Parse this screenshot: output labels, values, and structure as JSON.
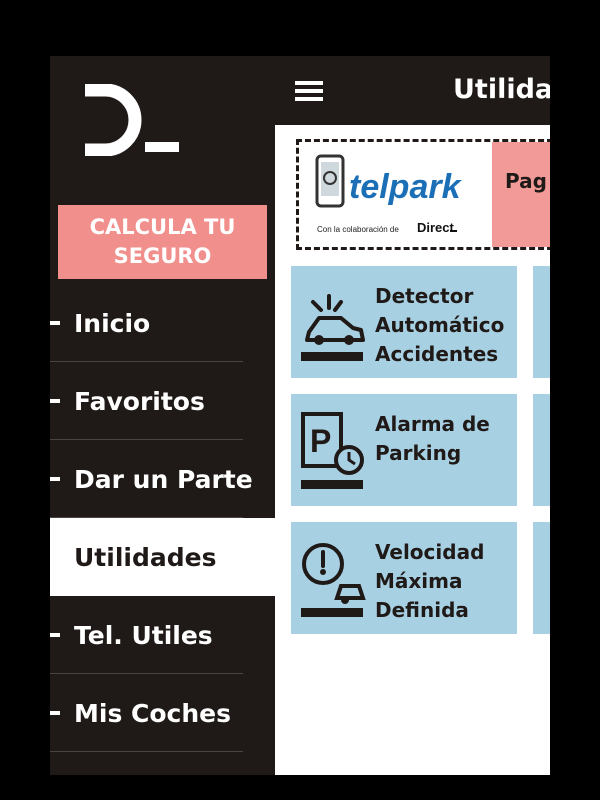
{
  "sidebar": {
    "cta_line1": "CALCULA TU",
    "cta_line2": "SEGURO",
    "items": [
      {
        "label": "Inicio"
      },
      {
        "label": "Favoritos"
      },
      {
        "label": "Dar un Parte"
      },
      {
        "label": "Utilidades",
        "active": true
      },
      {
        "label": "Tel. Utiles"
      },
      {
        "label": "Mis Coches"
      }
    ]
  },
  "header": {
    "title": "Utilidad"
  },
  "banner": {
    "brand": "telpark",
    "collab_text": "Con la colaboración de",
    "partner": "Direct",
    "pay_label": "Pag"
  },
  "tiles": [
    {
      "line1": "Detector",
      "line2": "Automático",
      "line3": "Accidentes",
      "icon": "car-crash-icon"
    },
    {
      "line1": "Alarma de",
      "line2": "Parking",
      "icon": "parking-alarm-icon"
    },
    {
      "line1": "Velocidad",
      "line2": "Máxima",
      "line3": "Definida",
      "icon": "speedometer-car-icon"
    }
  ],
  "colors": {
    "dark": "#1f1a17",
    "accent_pink": "#f08f8c",
    "tile_blue": "#a8d0e3",
    "telpark_blue": "#1a6fb6"
  }
}
